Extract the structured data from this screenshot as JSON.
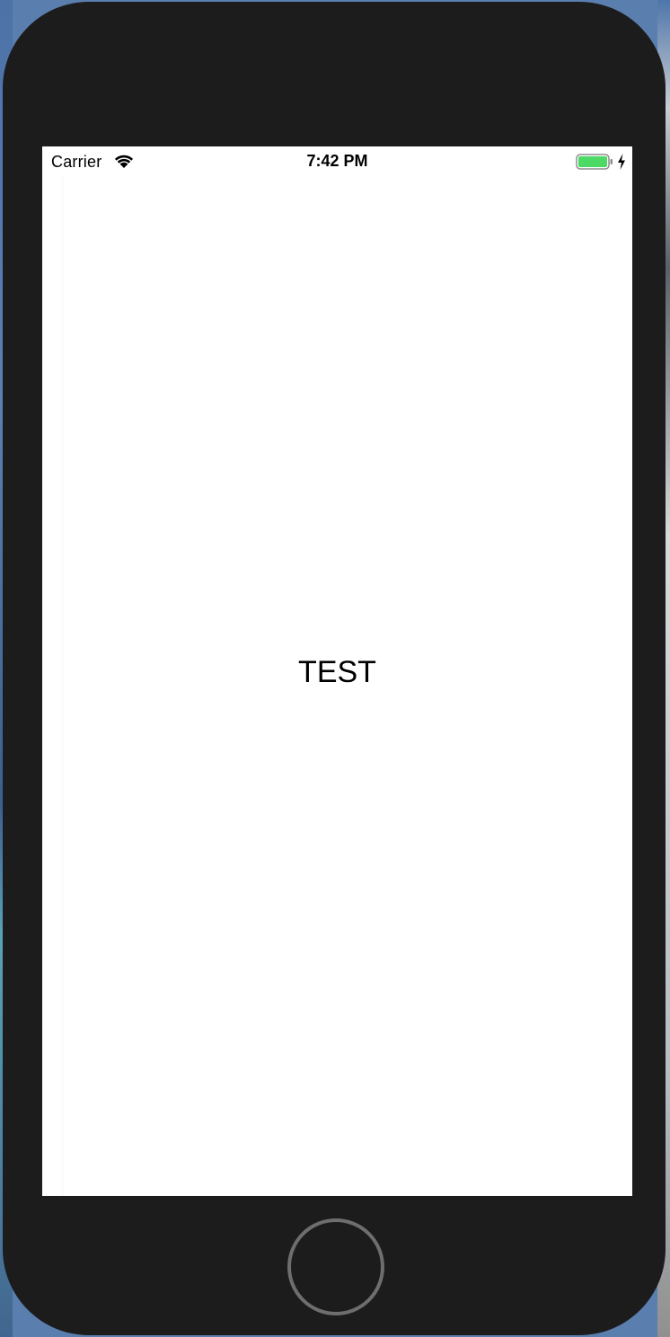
{
  "status_bar": {
    "carrier": "Carrier",
    "time": "7:42 PM",
    "wifi_icon": "wifi-icon",
    "battery_icon": "battery-icon",
    "charging_icon": "charging-bolt-icon",
    "battery_level": 1.0,
    "battery_color": "#4cd964"
  },
  "content": {
    "label": "TEST"
  },
  "device": {
    "frame_color": "#1c1c1c",
    "home_button_icon": "home-button"
  }
}
